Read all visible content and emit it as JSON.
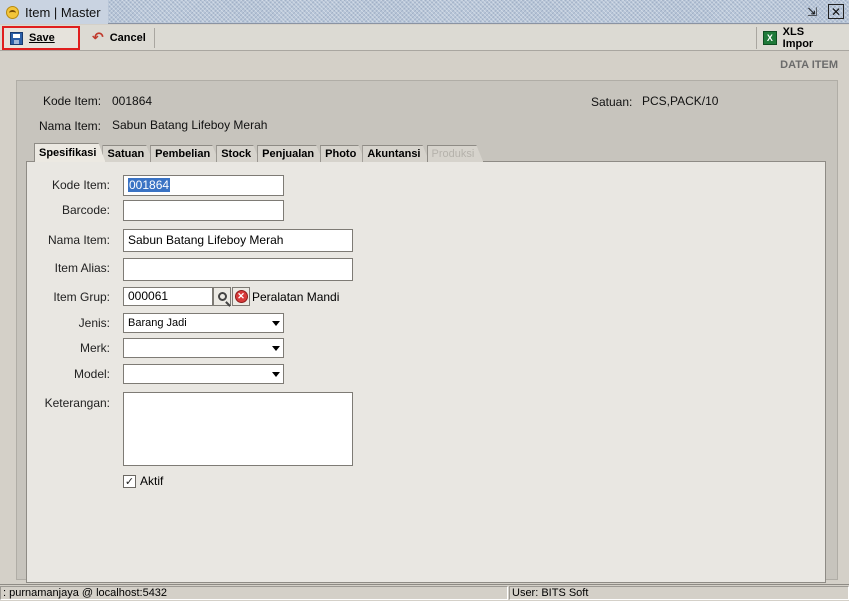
{
  "window": {
    "title": "Item | Master",
    "restore_icon": "restore-icon",
    "close_icon": "close-icon"
  },
  "toolbar": {
    "save_label": "Save",
    "cancel_label": "Cancel",
    "xls_label": "XLS Impor"
  },
  "section_label": "DATA ITEM",
  "header": {
    "kode_item_label": "Kode Item:",
    "kode_item_value": "001864",
    "nama_item_label": "Nama Item:",
    "nama_item_value": "Sabun Batang Lifeboy Merah",
    "satuan_label": "Satuan:",
    "satuan_value": "PCS,PACK/10"
  },
  "tabs": [
    {
      "label": "Spesifikasi",
      "active": true
    },
    {
      "label": "Satuan"
    },
    {
      "label": "Pembelian"
    },
    {
      "label": "Stock"
    },
    {
      "label": "Penjualan"
    },
    {
      "label": "Photo"
    },
    {
      "label": "Akuntansi"
    },
    {
      "label": "Produksi",
      "disabled": true
    }
  ],
  "form": {
    "kode_item_label": "Kode Item:",
    "kode_item_value": "001864",
    "barcode_label": "Barcode:",
    "barcode_value": "",
    "nama_item_label": "Nama Item:",
    "nama_item_value": "Sabun Batang Lifeboy Merah",
    "item_alias_label": "Item Alias:",
    "item_alias_value": "",
    "item_grup_label": "Item Grup:",
    "item_grup_value": "000061",
    "item_grup_name": "Peralatan Mandi",
    "jenis_label": "Jenis:",
    "jenis_value": "Barang Jadi",
    "merk_label": "Merk:",
    "merk_value": "",
    "model_label": "Model:",
    "model_value": "",
    "keterangan_label": "Keterangan:",
    "keterangan_value": "",
    "aktif_label": "Aktif",
    "aktif_checked": true
  },
  "status": {
    "connection": ": purnamanjaya @ localhost:5432",
    "user": "User: BITS Soft"
  }
}
